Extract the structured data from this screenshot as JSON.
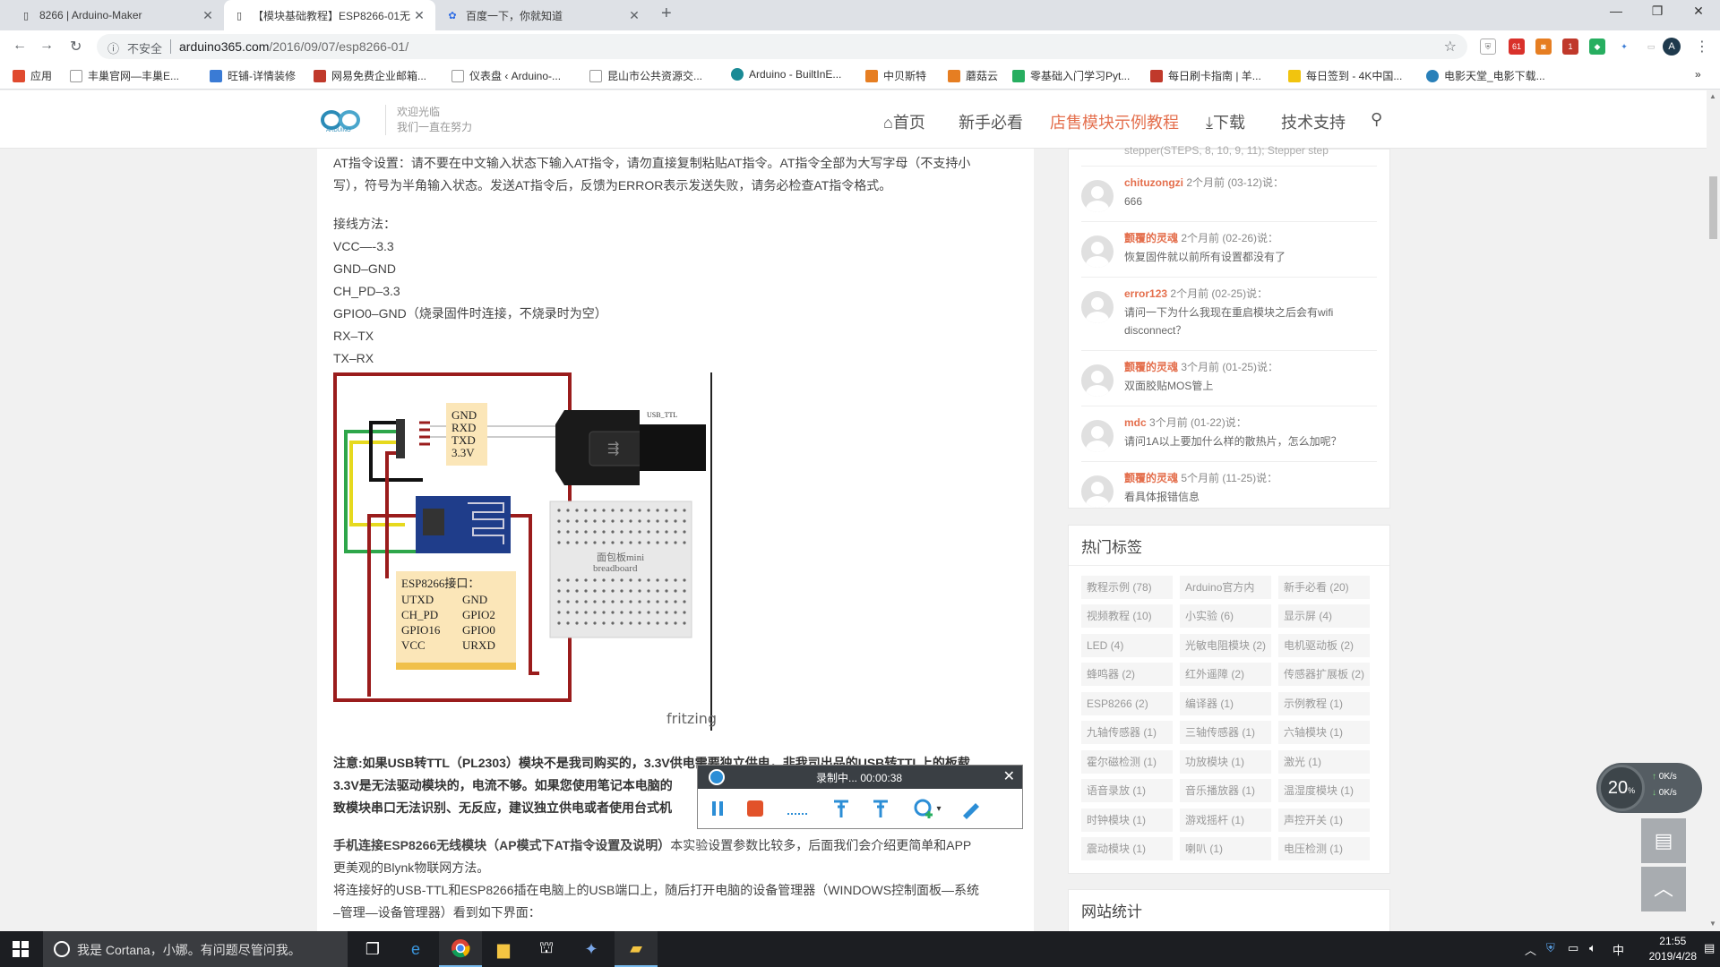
{
  "browser": {
    "tabs": [
      {
        "label": "8266 | Arduino-Maker",
        "icon": "page-icon",
        "active": false
      },
      {
        "label": "【模块基础教程】ESP8266-01无",
        "icon": "page-icon",
        "active": true
      },
      {
        "label": "百度一下，你就知道",
        "icon": "baidu-icon",
        "active": false
      }
    ],
    "new_tab_glyph": "+",
    "window_controls": [
      "—",
      "❐",
      "✕"
    ],
    "security_label": "不安全",
    "url_host": "arduino365.com",
    "url_path": "/2016/09/07/esp8266-01/",
    "avatar_letter": "A",
    "ext_badges": [
      "61",
      "1"
    ],
    "bookmarks": [
      {
        "label": "应用",
        "color": "#e04a2f"
      },
      {
        "label": "丰巢官网—丰巢E...",
        "color": "#cccccc"
      },
      {
        "label": "旺铺-详情装修",
        "color": "#3a7bd5"
      },
      {
        "label": "网易免费企业邮箱...",
        "color": "#c0392b"
      },
      {
        "label": "仪表盘 ‹ Arduino-...",
        "color": "#cccccc"
      },
      {
        "label": "昆山市公共资源交...",
        "color": "#cccccc"
      },
      {
        "label": "Arduino - BuiltInE...",
        "color": "#1a8a95"
      },
      {
        "label": "中贝斯特",
        "color": "#e67e22"
      },
      {
        "label": "蘑菇云",
        "color": "#e67e22"
      },
      {
        "label": "零基础入门学习Pyt...",
        "color": "#27ae60"
      },
      {
        "label": "每日刷卡指南 | 羊...",
        "color": "#c0392b"
      },
      {
        "label": "每日签到 - 4K中国...",
        "color": "#f1c40f"
      },
      {
        "label": "电影天堂_电影下载...",
        "color": "#2980b9"
      }
    ],
    "more_glyph": "»"
  },
  "site": {
    "tagline1": "欢迎光临",
    "tagline2": "我们一直在努力",
    "logo_text": "ARDUINO",
    "nav": [
      {
        "label": "首页",
        "icon": "home-icon",
        "active": false
      },
      {
        "label": "新手必看",
        "active": false
      },
      {
        "label": "店售模块示例教程",
        "active": true
      },
      {
        "label": "下载",
        "icon": "download-icon",
        "active": false
      },
      {
        "label": "技术支持",
        "active": false
      }
    ]
  },
  "article": {
    "at_intro1": "AT指令设置：请不要在中文输入状态下输入AT指令，请勿直接复制粘贴AT指令。AT指令全部为大写字母（不支持小",
    "at_intro2": "写），符号为半角输入状态。发送AT指令后，反馈为ERROR表示发送失败，请务必检查AT指令格式。",
    "wiring_title": "接线方法：",
    "wiring": [
      "VCC—-3.3",
      "GND–GND",
      "CH_PD–3.3",
      "GPIO0–GND（烧录固件时连接，不烧录时为空）",
      "RX–TX",
      "TX–RX"
    ],
    "note1": "注意:如果USB转TTL（PL2303）模块不是我司购买的，3.3V供电需要独立供电，非我司出品的USB转TTL上的板载",
    "note2": "3.3V是无法驱动模块的，电流不够。如果您使用笔记本电脑的",
    "note3": "致模块串口无法识别、无反应，建议独立供电或者使用台式机",
    "mode_title": "手机连接ESP8266无线模块（AP模式下AT指令设置及说明）",
    "mode_desc": "本实验设置参数比较多，后面我们会介绍更简单和APP",
    "mode_desc2": "更美观的Blynk物联网方法。",
    "devmgr1": "将连接好的USB-TTL和ESP8266插在电脑上的USB端口上，随后打开电脑的设备管理器（WINDOWS控制面板—系统",
    "devmgr2": "–管理—设备管理器）看到如下界面："
  },
  "figure": {
    "pin_labels": [
      "GND",
      "RXD",
      "TXD",
      "3.3V"
    ],
    "usb_label": "USB_TTL",
    "esp_title": "ESP8266接口：",
    "esp_pins_left": [
      "UTXD",
      "CH_PD",
      "GPIO16",
      "VCC"
    ],
    "esp_pins_right": [
      "GND",
      "GPIO2",
      "GPIO0",
      "URXD"
    ],
    "breadboard_label1": "面包板mini",
    "breadboard_label2": "breadboard",
    "fritzing": "fritzing"
  },
  "comments_top_fragment": "stepper(STEPS, 8, 10, 9, 11); Stepper step",
  "comments": [
    {
      "user": "chituzongzi",
      "meta": "2个月前 (03-12)说：",
      "text": "666"
    },
    {
      "user": "颤覆的灵魂",
      "meta": "2个月前 (02-26)说：",
      "text": "恢复固件就以前所有设置都没有了"
    },
    {
      "user": "error123",
      "meta": "2个月前 (02-25)说：",
      "text": "请问一下为什么我现在重启模块之后会有wifi disconnect？"
    },
    {
      "user": "颤覆的灵魂",
      "meta": "3个月前 (01-25)说：",
      "text": "双面胶贴MOS管上"
    },
    {
      "user": "mdc",
      "meta": "3个月前 (01-22)说：",
      "text": "请问1A以上要加什么样的散热片，怎么加呢？"
    },
    {
      "user": "颤覆的灵魂",
      "meta": "5个月前 (11-25)说：",
      "text": "看具体报错信息"
    }
  ],
  "tags_title": "热门标签",
  "tags": [
    "教程示例 (78)",
    "Arduino官方内",
    "新手必看 (20)",
    "视频教程 (10)",
    "小实验 (6)",
    "显示屏 (4)",
    "LED (4)",
    "光敏电阻模块 (2)",
    "电机驱动板 (2)",
    "蜂鸣器 (2)",
    "红外遥障 (2)",
    "传感器扩展板 (2)",
    "ESP8266 (2)",
    "编译器 (1)",
    "示例教程 (1)",
    "九轴传感器 (1)",
    "三轴传感器 (1)",
    "六轴模块 (1)",
    "霍尔磁检测 (1)",
    "功放模块 (1)",
    "激光 (1)",
    "语音录放 (1)",
    "音乐播放器 (1)",
    "温湿度模块 (1)",
    "时钟模块 (1)",
    "游戏摇杆 (1)",
    "声控开关 (1)",
    "震动模块 (1)",
    "喇叭 (1)",
    "电压检测 (1)"
  ],
  "stats_title": "网站统计",
  "speed": {
    "value": "20",
    "unit": "%",
    "up": "0K/s",
    "down": "0K/s"
  },
  "recorder": {
    "title": "录制中... 00:00:38",
    "close": "✕"
  },
  "taskbar": {
    "cortana_text": "我是 Cortana，小娜。有问题尽管问我。",
    "time": "21:55",
    "date": "2019/4/28",
    "ime": "中"
  }
}
